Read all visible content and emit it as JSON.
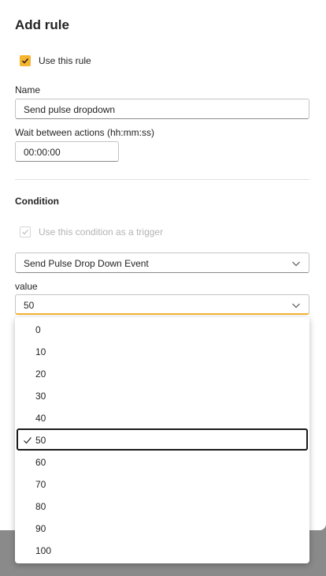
{
  "dialog": {
    "title": "Add rule",
    "use_rule_label": "Use this rule",
    "name_label": "Name",
    "name_value": "Send pulse dropdown",
    "wait_label": "Wait between actions (hh:mm:ss)",
    "wait_value": "00:00:00"
  },
  "condition": {
    "section_title": "Condition",
    "trigger_label": "Use this condition as a trigger",
    "event_select": "Send Pulse Drop Down Event",
    "value_label": "value",
    "value_select": "50"
  },
  "options": [
    "0",
    "10",
    "20",
    "30",
    "40",
    "50",
    "60",
    "70",
    "80",
    "90",
    "100"
  ],
  "selected_option": "50",
  "colors": {
    "accent": "#f5b531"
  }
}
